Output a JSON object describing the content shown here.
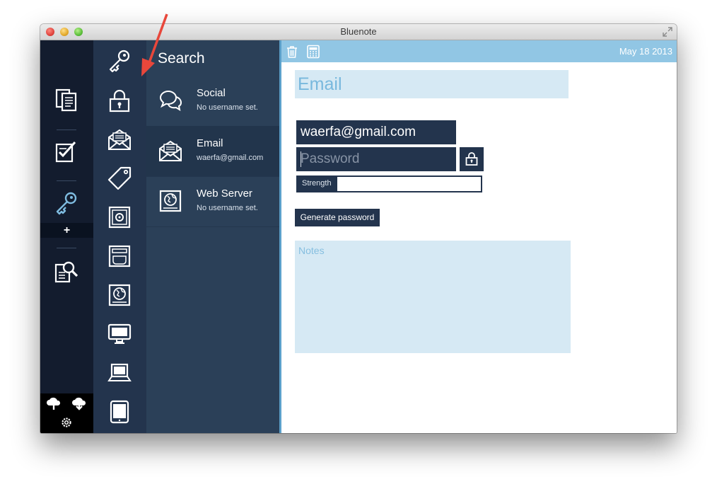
{
  "window": {
    "title": "Bluenote"
  },
  "toolbar": {
    "date": "May 18 2013"
  },
  "sidebar_nav": {
    "items": [
      "notes-icon",
      "edit-note-icon",
      "key-icon",
      "search-notes-icon"
    ],
    "add_label": "+",
    "bottom": [
      "cloud-upload-icon",
      "cloud-download-icon",
      "gear-icon"
    ]
  },
  "category_nav": {
    "items": [
      "key-icon",
      "lock-icon",
      "envelope-icon",
      "tag-icon",
      "safe-icon",
      "drive-icon",
      "web-server-icon",
      "monitor-icon",
      "laptop-icon",
      "tablet-icon"
    ]
  },
  "search": {
    "title": "Search"
  },
  "entries": [
    {
      "title": "Social",
      "subtitle": "No username set.",
      "icon": "chat-bubbles-icon"
    },
    {
      "title": "Email",
      "subtitle": "waerfa@gmail.com",
      "icon": "envelope-icon"
    },
    {
      "title": "Web Server",
      "subtitle": "No username set.",
      "icon": "web-server-icon"
    }
  ],
  "detail": {
    "title": "Email",
    "username": "waerfa@gmail.com",
    "password_placeholder": "Password",
    "strength_label": "Strength",
    "generate_label": "Generate password",
    "notes_placeholder": "Notes"
  },
  "colors": {
    "nav_dark": "#131c2e",
    "nav_mid": "#23344d",
    "list_bg": "#2b4058",
    "accent": "#91c6e4",
    "field_light": "#d6e9f4"
  }
}
